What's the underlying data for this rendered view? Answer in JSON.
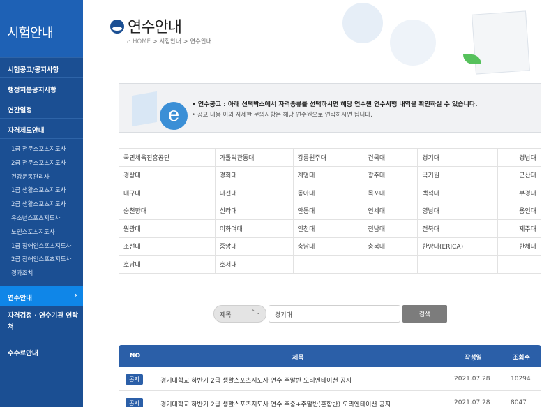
{
  "sidebar": {
    "title": "시험안내",
    "menu": [
      {
        "label": "시험공고/공지사항"
      },
      {
        "label": "행정처분공지사항"
      },
      {
        "label": "연간일정"
      },
      {
        "label": "자격제도안내"
      }
    ],
    "sub_items": [
      "1급 전문스포츠지도사",
      "2급 전문스포츠지도사",
      "건강운동관리사",
      "1급 생활스포츠지도사",
      "2급 생활스포츠지도사",
      "유소년스포츠지도사",
      "노인스포츠지도사",
      "1급 장애인스포츠지도사",
      "2급 장애인스포츠지도사",
      "경과조치"
    ],
    "active": "연수안내",
    "active_chevron": "›",
    "lower": [
      "자격검정 · 연수기관 연락처",
      "수수료안내"
    ]
  },
  "header": {
    "title": "연수안내",
    "breadcrumb_home": "⌂ HOME",
    "breadcrumb": "> 시험안내 > 연수안내"
  },
  "notice": {
    "line1": "• 연수공고 : 아래 선택박스에서 자격종류를 선택하시면 해당 연수원 연수시행 내역을 확인하실 수 있습니다.",
    "line2": "• 공고 내용 이외 자세한 문의사항은 해당 연수원으로 연락하시면 됩니다.",
    "e_glyph": "e"
  },
  "institutions": [
    [
      "국민체육진흥공단",
      "가톨릭관동대",
      "강릉원주대",
      "건국대",
      "경기대",
      "경남대"
    ],
    [
      "경상대",
      "경희대",
      "계명대",
      "광주대",
      "국기원",
      "군산대"
    ],
    [
      "대구대",
      "대전대",
      "동아대",
      "목포대",
      "백석대",
      "부경대"
    ],
    [
      "순천향대",
      "신라대",
      "안동대",
      "연세대",
      "영남대",
      "용인대"
    ],
    [
      "원광대",
      "이화여대",
      "인천대",
      "전남대",
      "전북대",
      "제주대"
    ],
    [
      "조선대",
      "중앙대",
      "충남대",
      "충북대",
      "한양대(ERICA)",
      "한체대"
    ],
    [
      "호남대",
      "호서대",
      "",
      "",
      "",
      ""
    ]
  ],
  "search": {
    "select_value": "제목",
    "select_arrow": "⌃⌄",
    "keyword": "경기대",
    "button": "검색"
  },
  "board": {
    "headers": {
      "no": "NO",
      "title": "제목",
      "date": "작성일",
      "views": "조회수"
    },
    "rows": [
      {
        "badge": "공지",
        "title": "경기대학교 하반기 2급 생활스포츠지도사 연수 주말반 오리엔테이션 공지",
        "date": "2021.07.28",
        "views": "10294"
      },
      {
        "badge": "공지",
        "title": "경기대학교 하반기 2급 생활스포츠지도사 연수 주중+주말반(혼합반) 오리엔테이션 공지",
        "date": "2021.07.28",
        "views": "8047"
      }
    ]
  },
  "colors": {
    "sidebar": "#1b4f93",
    "sidebar_title": "#1e61b5",
    "active": "#0f86e8",
    "board_head": "#2b5fa8"
  }
}
